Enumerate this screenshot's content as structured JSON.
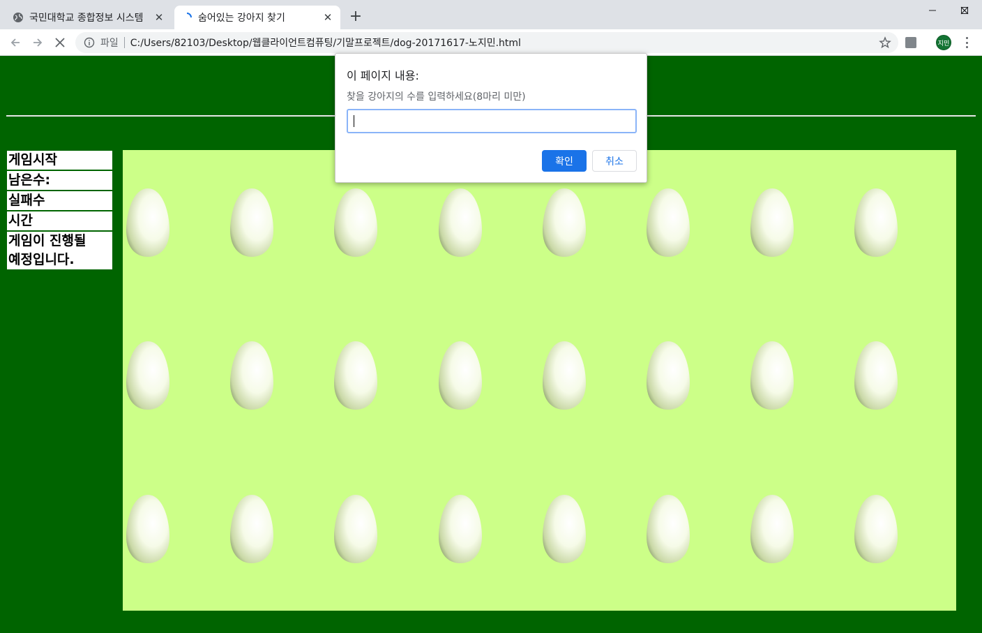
{
  "browser": {
    "tabs": [
      {
        "title": "국민대학교 종합정보 시스템",
        "close": "✕"
      },
      {
        "title": "숨어있는 강아지 찾기",
        "close": "✕"
      }
    ],
    "new_tab": "+",
    "window_controls": {
      "minimize": "—",
      "maximize": "☐",
      "close": "✕"
    },
    "address": {
      "scheme": "파일",
      "url": "C:/Users/82103/Desktop/웹클라이언트컴퓨팅/기말프로젝트/dog-20171617-노지민.html"
    },
    "profile_label": "지민"
  },
  "sidebar": {
    "start": "게임시작",
    "remaining": "남은수:",
    "fails": "실패수",
    "time": "시간",
    "status_line1": "게임이 진행될",
    "status_line2": "예정입니다."
  },
  "board": {
    "rows": 3,
    "cols": 8,
    "background": "#ccff88",
    "item_icon": "egg-icon"
  },
  "dialog": {
    "title": "이 페이지 내용:",
    "message": "찾을 강아지의 수를 입력하세요(8마리 미만)",
    "input_value": "",
    "ok_label": "확인",
    "cancel_label": "취소"
  },
  "colors": {
    "page_bg": "#006400",
    "board_bg": "#ccff88",
    "accent": "#1a73e8"
  }
}
